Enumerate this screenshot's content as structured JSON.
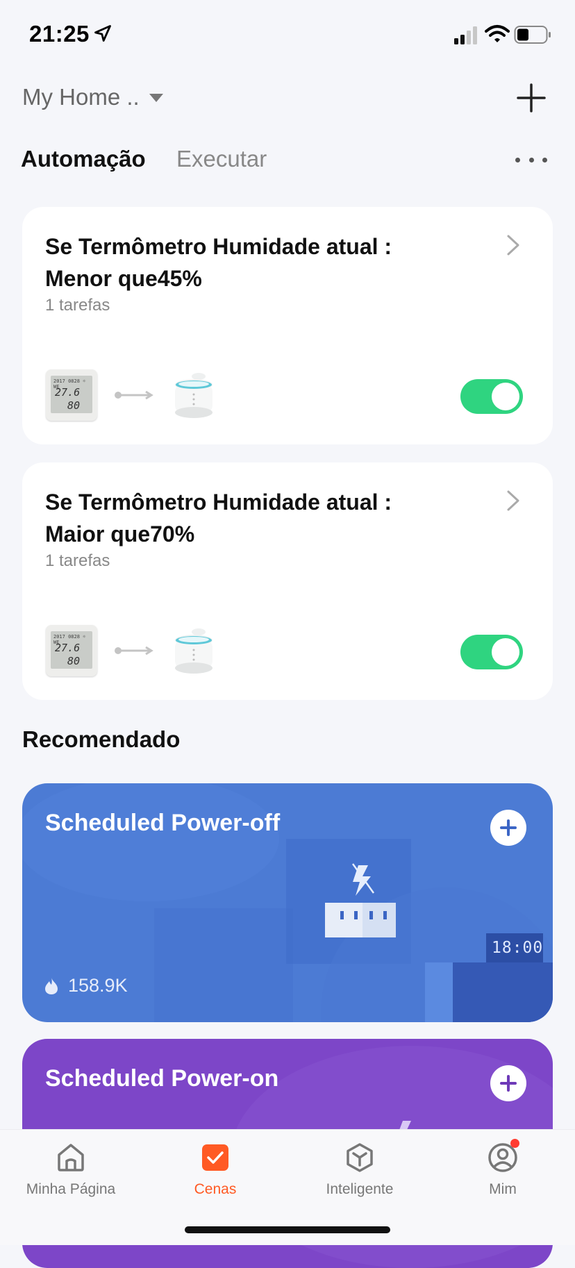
{
  "status_bar": {
    "time": "21:25",
    "icons": [
      "location-arrow-icon",
      "signal-icon",
      "wifi-icon",
      "battery-icon"
    ]
  },
  "header": {
    "home_name": "My Home ..",
    "add_icon": "plus-icon"
  },
  "tabs": [
    {
      "label": "Automação",
      "active": true
    },
    {
      "label": "Executar",
      "active": false
    }
  ],
  "automations": [
    {
      "title": "Se Termômetro  Humidade atual :\nMenor que45%",
      "tasks": "1 tarefas",
      "enabled": true,
      "device_display": {
        "line1": "2017 0828 ☼ WE",
        "temp": "27.6",
        "humidity": "80"
      }
    },
    {
      "title": "Se Termômetro  Humidade atual :\nMaior que70%",
      "tasks": "1 tarefas",
      "enabled": true,
      "device_display": {
        "line1": "2017 0828 ☼ WE",
        "temp": "27.6",
        "humidity": "80"
      }
    }
  ],
  "recommended": {
    "title": "Recomendado",
    "cards": [
      {
        "title": "Scheduled Power-off",
        "stat": "158.9K",
        "clock_display": "18:00",
        "color": "#4c7bd4"
      },
      {
        "title": "Scheduled Power-on",
        "color": "#7d46c8"
      }
    ]
  },
  "bottom_nav": [
    {
      "label": "Minha Página",
      "icon": "home-icon",
      "active": false
    },
    {
      "label": "Cenas",
      "icon": "scenes-check-icon",
      "active": true
    },
    {
      "label": "Inteligente",
      "icon": "smart-cube-icon",
      "active": false
    },
    {
      "label": "Mim",
      "icon": "profile-icon",
      "active": false,
      "badge": true
    }
  ],
  "colors": {
    "accent": "#ff5a24",
    "toggle_on": "#2fd480",
    "background": "#f5f6fa"
  }
}
